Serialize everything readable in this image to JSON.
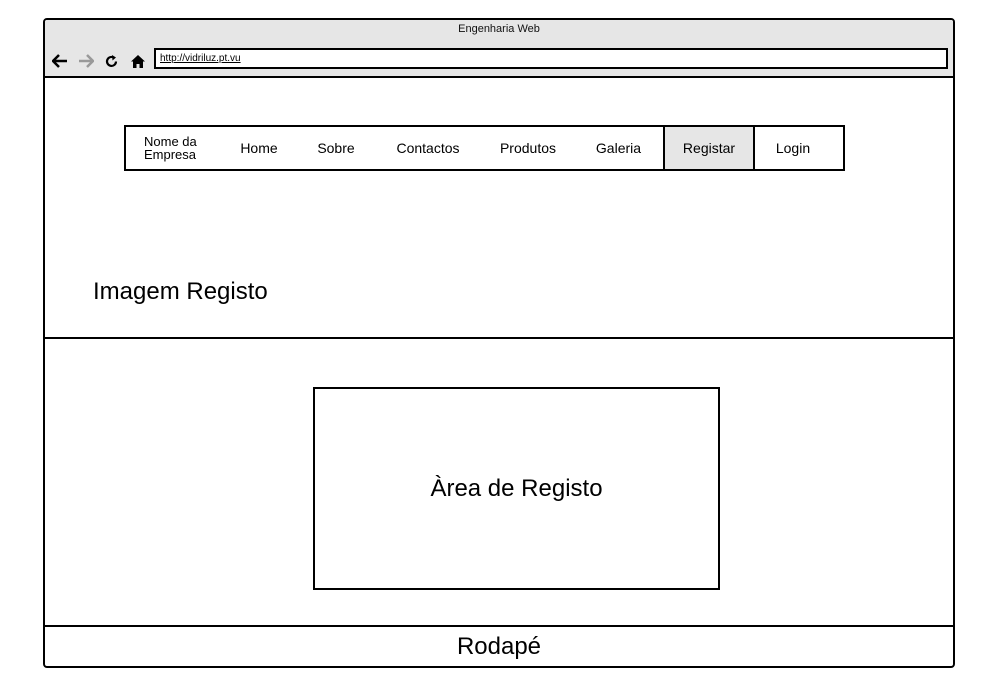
{
  "window": {
    "title": "Engenharia Web"
  },
  "browser": {
    "url": "http://vidriluz.pt.vu",
    "icons": [
      "back-icon",
      "forward-icon",
      "refresh-icon",
      "home-icon"
    ]
  },
  "nav": {
    "brand_line1": "Nome da",
    "brand_line2": "Empresa",
    "items": [
      {
        "label": "Home"
      },
      {
        "label": "Sobre"
      },
      {
        "label": "Contactos"
      },
      {
        "label": "Produtos"
      },
      {
        "label": "Galeria"
      },
      {
        "label": "Registar",
        "active": true
      },
      {
        "label": "Login"
      }
    ]
  },
  "header": {
    "image_label": "Imagem Registo"
  },
  "main": {
    "register_area_label": "Àrea de Registo"
  },
  "footer": {
    "label": "Rodapé"
  },
  "colors": {
    "chrome_bg": "#e6e6e6",
    "active_tab_bg": "#e6e6e6",
    "border": "#000000"
  }
}
